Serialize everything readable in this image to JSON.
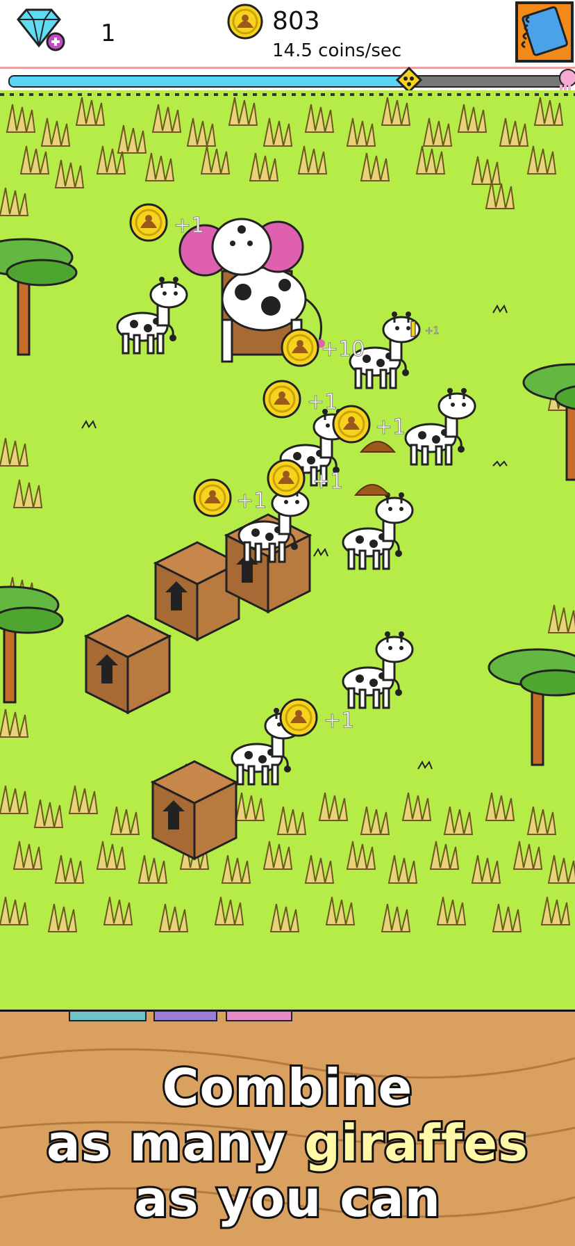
{
  "hud": {
    "gems": "1",
    "coins": "803",
    "coins_rate": "14.5 coins/sec",
    "progress_fraction": 0.71
  },
  "icons": {
    "gem": "diamond-plus-icon",
    "coin": "poop-coin-icon",
    "book": "evolution-book-icon",
    "next_creature": "next-evolution-icon"
  },
  "floating_texts": {
    "t1": "+1",
    "t2": "+10",
    "t3": "+1",
    "t4": "+1",
    "t5": "+1",
    "t6": "+1",
    "t7": "+1",
    "t8": "+1"
  },
  "caption": {
    "line1": "Combine",
    "line2_a": "as many ",
    "line2_b": "giraffes",
    "line3": "as you can"
  },
  "colors": {
    "grass": "#b5ec48",
    "progress": "#5ad5f5",
    "coin": "#f7d21e",
    "wood": "#d9a05f",
    "book": "#f28a1a"
  }
}
